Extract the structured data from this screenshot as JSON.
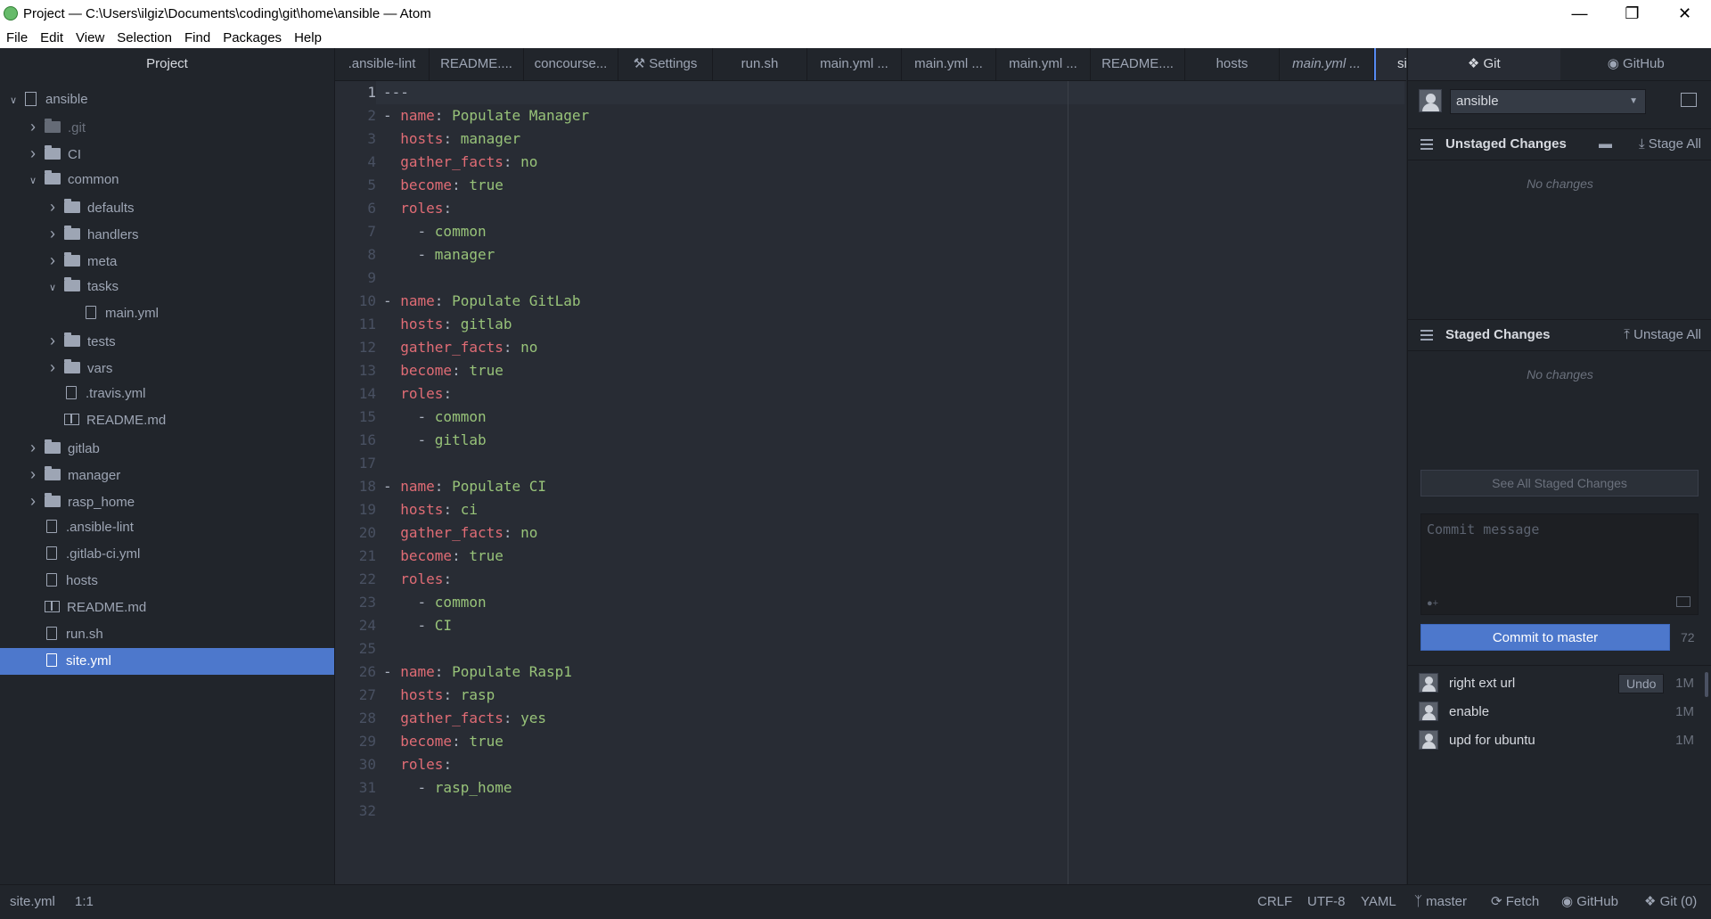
{
  "window": {
    "title": "Project — C:\\Users\\ilgiz\\Documents\\coding\\git\\home\\ansible — Atom"
  },
  "menu": [
    "File",
    "Edit",
    "View",
    "Selection",
    "Find",
    "Packages",
    "Help"
  ],
  "tree": {
    "header": "Project",
    "rows": [
      {
        "label": "ansible",
        "kind": "repo",
        "depth": 0,
        "chevron": "down"
      },
      {
        "label": ".git",
        "kind": "folder",
        "depth": 1,
        "chevron": "right",
        "dim": true
      },
      {
        "label": "CI",
        "kind": "folder",
        "depth": 1,
        "chevron": "right"
      },
      {
        "label": "common",
        "kind": "folder",
        "depth": 1,
        "chevron": "down"
      },
      {
        "label": "defaults",
        "kind": "folder",
        "depth": 2,
        "chevron": "right"
      },
      {
        "label": "handlers",
        "kind": "folder",
        "depth": 2,
        "chevron": "right"
      },
      {
        "label": "meta",
        "kind": "folder",
        "depth": 2,
        "chevron": "right"
      },
      {
        "label": "tasks",
        "kind": "folder",
        "depth": 2,
        "chevron": "down"
      },
      {
        "label": "main.yml",
        "kind": "file",
        "depth": 3
      },
      {
        "label": "tests",
        "kind": "folder",
        "depth": 2,
        "chevron": "right"
      },
      {
        "label": "vars",
        "kind": "folder",
        "depth": 2,
        "chevron": "right"
      },
      {
        "label": ".travis.yml",
        "kind": "file",
        "depth": 2
      },
      {
        "label": "README.md",
        "kind": "book",
        "depth": 2
      },
      {
        "label": "gitlab",
        "kind": "folder",
        "depth": 1,
        "chevron": "right"
      },
      {
        "label": "manager",
        "kind": "folder",
        "depth": 1,
        "chevron": "right"
      },
      {
        "label": "rasp_home",
        "kind": "folder",
        "depth": 1,
        "chevron": "right"
      },
      {
        "label": ".ansible-lint",
        "kind": "file",
        "depth": 1
      },
      {
        "label": ".gitlab-ci.yml",
        "kind": "file",
        "depth": 1
      },
      {
        "label": "hosts",
        "kind": "file",
        "depth": 1
      },
      {
        "label": "README.md",
        "kind": "book",
        "depth": 1
      },
      {
        "label": "run.sh",
        "kind": "file",
        "depth": 1
      },
      {
        "label": "site.yml",
        "kind": "file",
        "depth": 1,
        "selected": true
      }
    ]
  },
  "tabs": [
    {
      "label": ".ansible-lint"
    },
    {
      "label": "README...."
    },
    {
      "label": "concourse..."
    },
    {
      "label": "Settings",
      "icon": "settings-icon"
    },
    {
      "label": "run.sh"
    },
    {
      "label": "main.yml ..."
    },
    {
      "label": "main.yml ..."
    },
    {
      "label": "main.yml ..."
    },
    {
      "label": "README...."
    },
    {
      "label": "hosts"
    },
    {
      "label": "main.yml ...",
      "italic": true
    },
    {
      "label": "site",
      "active": true
    }
  ],
  "editor": {
    "current_line": 1,
    "lines": [
      [
        [
          "d",
          "---"
        ]
      ],
      [
        [
          "d",
          "- "
        ],
        [
          "k",
          "name"
        ],
        [
          "d",
          ": "
        ],
        [
          "v",
          "Populate Manager"
        ]
      ],
      [
        [
          "d",
          "  "
        ],
        [
          "k",
          "hosts"
        ],
        [
          "d",
          ": "
        ],
        [
          "v",
          "manager"
        ]
      ],
      [
        [
          "d",
          "  "
        ],
        [
          "k",
          "gather_facts"
        ],
        [
          "d",
          ": "
        ],
        [
          "v",
          "no"
        ]
      ],
      [
        [
          "d",
          "  "
        ],
        [
          "k",
          "become"
        ],
        [
          "d",
          ": "
        ],
        [
          "v",
          "true"
        ]
      ],
      [
        [
          "d",
          "  "
        ],
        [
          "k",
          "roles"
        ],
        [
          "d",
          ":"
        ]
      ],
      [
        [
          "d",
          "    - "
        ],
        [
          "v",
          "common"
        ]
      ],
      [
        [
          "d",
          "    - "
        ],
        [
          "v",
          "manager"
        ]
      ],
      [],
      [
        [
          "d",
          "- "
        ],
        [
          "k",
          "name"
        ],
        [
          "d",
          ": "
        ],
        [
          "v",
          "Populate GitLab"
        ]
      ],
      [
        [
          "d",
          "  "
        ],
        [
          "k",
          "hosts"
        ],
        [
          "d",
          ": "
        ],
        [
          "v",
          "gitlab"
        ]
      ],
      [
        [
          "d",
          "  "
        ],
        [
          "k",
          "gather_facts"
        ],
        [
          "d",
          ": "
        ],
        [
          "v",
          "no"
        ]
      ],
      [
        [
          "d",
          "  "
        ],
        [
          "k",
          "become"
        ],
        [
          "d",
          ": "
        ],
        [
          "v",
          "true"
        ]
      ],
      [
        [
          "d",
          "  "
        ],
        [
          "k",
          "roles"
        ],
        [
          "d",
          ":"
        ]
      ],
      [
        [
          "d",
          "    - "
        ],
        [
          "v",
          "common"
        ]
      ],
      [
        [
          "d",
          "    - "
        ],
        [
          "v",
          "gitlab"
        ]
      ],
      [],
      [
        [
          "d",
          "- "
        ],
        [
          "k",
          "name"
        ],
        [
          "d",
          ": "
        ],
        [
          "v",
          "Populate CI"
        ]
      ],
      [
        [
          "d",
          "  "
        ],
        [
          "k",
          "hosts"
        ],
        [
          "d",
          ": "
        ],
        [
          "v",
          "ci"
        ]
      ],
      [
        [
          "d",
          "  "
        ],
        [
          "k",
          "gather_facts"
        ],
        [
          "d",
          ": "
        ],
        [
          "v",
          "no"
        ]
      ],
      [
        [
          "d",
          "  "
        ],
        [
          "k",
          "become"
        ],
        [
          "d",
          ": "
        ],
        [
          "v",
          "true"
        ]
      ],
      [
        [
          "d",
          "  "
        ],
        [
          "k",
          "roles"
        ],
        [
          "d",
          ":"
        ]
      ],
      [
        [
          "d",
          "    - "
        ],
        [
          "v",
          "common"
        ]
      ],
      [
        [
          "d",
          "    - "
        ],
        [
          "v",
          "CI"
        ]
      ],
      [],
      [
        [
          "d",
          "- "
        ],
        [
          "k",
          "name"
        ],
        [
          "d",
          ": "
        ],
        [
          "v",
          "Populate Rasp1"
        ]
      ],
      [
        [
          "d",
          "  "
        ],
        [
          "k",
          "hosts"
        ],
        [
          "d",
          ": "
        ],
        [
          "v",
          "rasp"
        ]
      ],
      [
        [
          "d",
          "  "
        ],
        [
          "k",
          "gather_facts"
        ],
        [
          "d",
          ": "
        ],
        [
          "v",
          "yes"
        ]
      ],
      [
        [
          "d",
          "  "
        ],
        [
          "k",
          "become"
        ],
        [
          "d",
          ": "
        ],
        [
          "v",
          "true"
        ]
      ],
      [
        [
          "d",
          "  "
        ],
        [
          "k",
          "roles"
        ],
        [
          "d",
          ":"
        ]
      ],
      [
        [
          "d",
          "    - "
        ],
        [
          "v",
          "rasp_home"
        ]
      ],
      []
    ]
  },
  "git": {
    "tab_git": "Git",
    "tab_github": "GitHub",
    "repo": "ansible",
    "unstaged_label": "Unstaged Changes",
    "stage_all": "Stage All",
    "unstaged_empty": "No changes",
    "staged_label": "Staged Changes",
    "unstage_all": "Unstage All",
    "staged_empty": "No changes",
    "see_all": "See All Staged Changes",
    "commit_placeholder": "Commit message",
    "commit_button": "Commit to master",
    "remaining_chars": "72",
    "undo": "Undo",
    "commits": [
      {
        "message": "right ext url",
        "age": "1M",
        "undo": true
      },
      {
        "message": "enable",
        "age": "1M"
      },
      {
        "message": "upd for ubuntu",
        "age": "1M"
      }
    ]
  },
  "status": {
    "file": "site.yml",
    "cursor": "1:1",
    "line_ending": "CRLF",
    "encoding": "UTF-8",
    "grammar": "YAML",
    "branch": "master",
    "fetch": "Fetch",
    "github": "GitHub",
    "git": "Git (0)"
  }
}
